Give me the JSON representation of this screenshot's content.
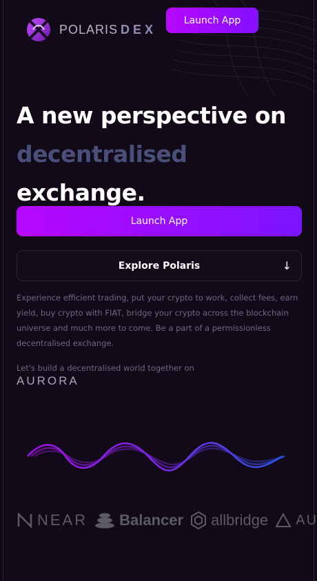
{
  "header": {
    "brand_name": "POLARIS",
    "brand_suffix": "DEX",
    "launch_button": "Launch App"
  },
  "hero": {
    "line1": "A new perspective on",
    "accent_word": "decentralised",
    "line2_rest": "exchange."
  },
  "actions": {
    "launch_app": "Launch App",
    "explore": "Explore Polaris"
  },
  "description": "Experience efficient trading, put your crypto to work, collect fees, earn yield, buy crypto with FIAT, bridge your crypto across the blockchain universe and much more to come. Be a part of a permissionless decentralised exchange.",
  "build_note": "Let's build a decentralised world together on",
  "aurora_logo": "AURORA",
  "partners": [
    {
      "name": "NEAR",
      "icon": "near-icon"
    },
    {
      "name": "Balancer",
      "icon": "balancer-icon"
    },
    {
      "name": "allbridge",
      "icon": "allbridge-icon"
    },
    {
      "name": "AURO",
      "icon": "aurora-icon"
    }
  ],
  "colors": {
    "background": "#120a18",
    "button_gradient_start": "#b707ff",
    "button_gradient_end": "#7c14ff",
    "accent_text": "#4a4f7a",
    "muted_text": "#6f6780"
  }
}
